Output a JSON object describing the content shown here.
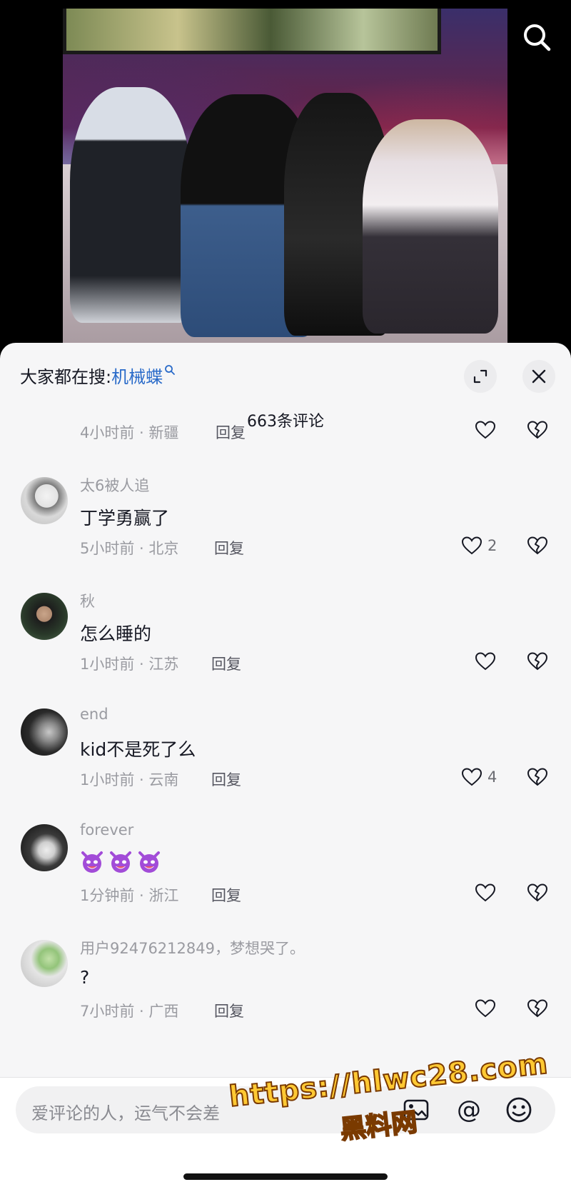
{
  "video": {
    "search_icon": "search-icon"
  },
  "sheet": {
    "trending_prefix": "大家都在搜:",
    "trending_keyword": "机械蝶",
    "comment_count": "663条评论",
    "expand_icon": "expand-icon",
    "close_icon": "close-icon"
  },
  "comments": [
    {
      "name": "",
      "text": "",
      "time": "4小时前",
      "location": "新疆",
      "reply": "回复",
      "likes": ""
    },
    {
      "name": "太6被人追",
      "text": "丁学勇赢了",
      "time": "5小时前",
      "location": "北京",
      "reply": "回复",
      "likes": "2"
    },
    {
      "name": "秋",
      "text": "怎么睡的",
      "time": "1小时前",
      "location": "江苏",
      "reply": "回复",
      "likes": ""
    },
    {
      "name": "end",
      "text": "kid不是死了么",
      "time": "1小时前",
      "location": "云南",
      "reply": "回复",
      "likes": "4"
    },
    {
      "name": "forever",
      "text": "",
      "emoji": [
        "devil-face-emoji",
        "devil-face-emoji",
        "devil-face-emoji"
      ],
      "time": "1分钟前",
      "location": "浙江",
      "reply": "回复",
      "likes": ""
    },
    {
      "name": "用户92476212849，梦想哭了。",
      "text": "?",
      "time": "7小时前",
      "location": "广西",
      "reply": "回复",
      "likes": ""
    }
  ],
  "composer": {
    "placeholder": "爱评论的人，运气不会差",
    "icons": [
      "image-icon",
      "at-icon",
      "emoji-icon"
    ],
    "at_symbol": "@"
  },
  "watermark": {
    "line1": "https://hlwc28.com",
    "line2": "黑料网"
  },
  "colors": {
    "keyword": "#2a6bc9",
    "meta": "#9a9ba1",
    "sheet_bg": "#f6f6f7"
  }
}
